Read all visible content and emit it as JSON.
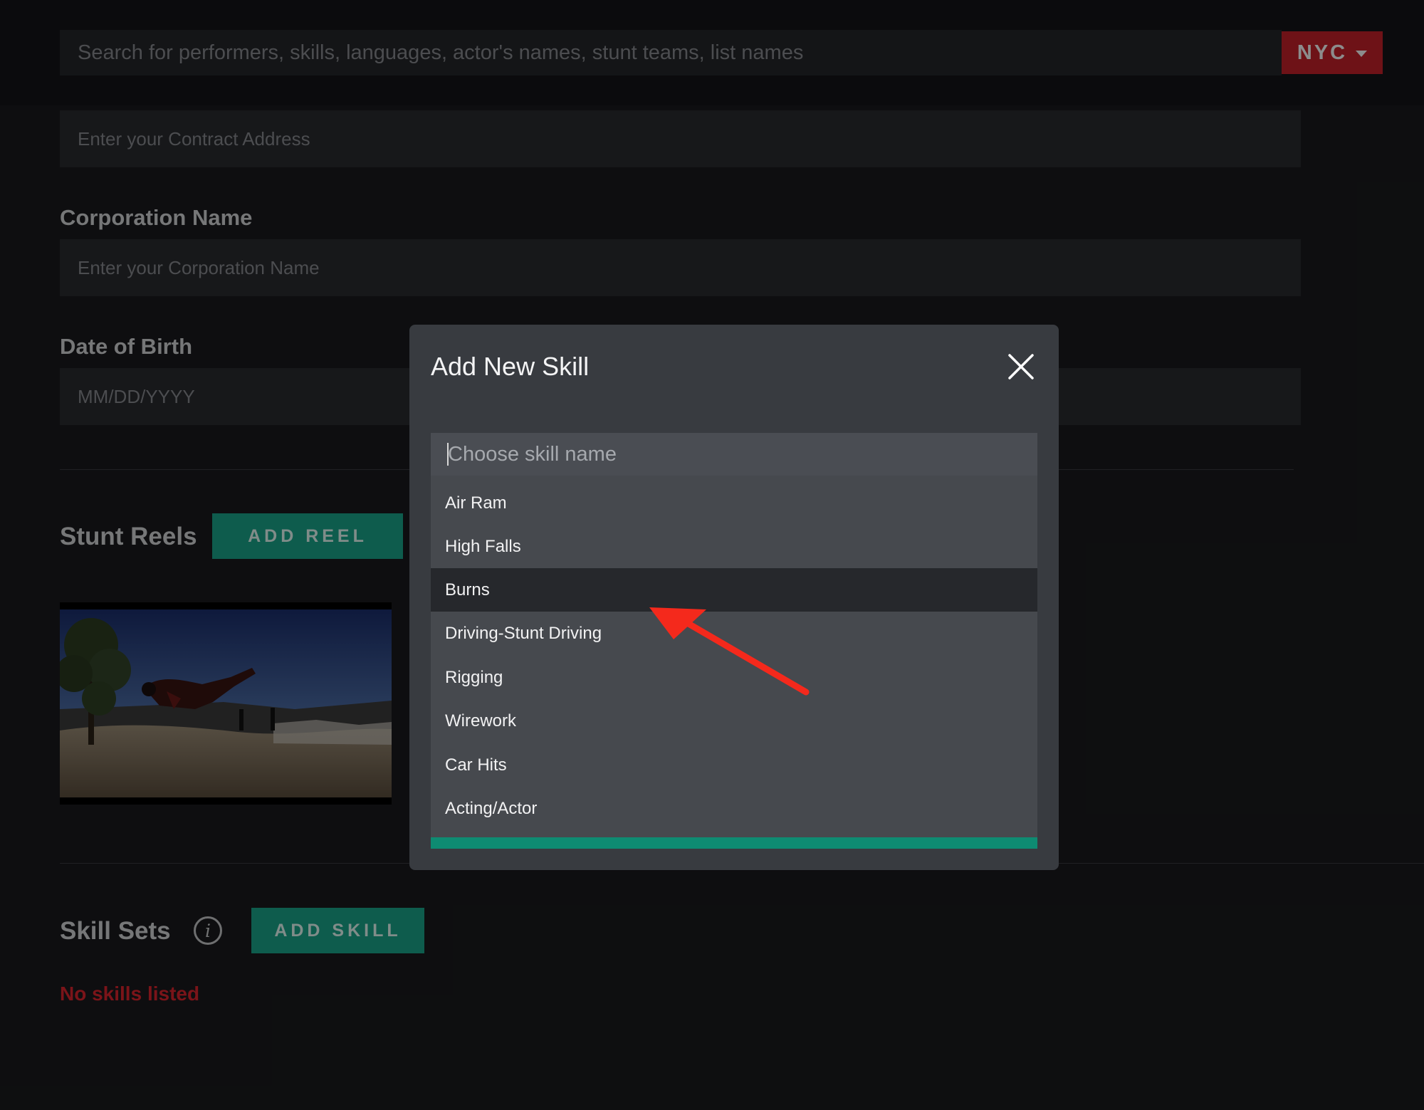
{
  "search": {
    "placeholder": "Search for performers, skills, languages, actor's names, stunt teams, list names",
    "city": "NYC"
  },
  "form": {
    "contract_address_placeholder": "Enter your Contract Address",
    "corporation_label": "Corporation Name",
    "corporation_placeholder": "Enter your Corporation Name",
    "dob_label": "Date of Birth",
    "dob_placeholder": "MM/DD/YYYY"
  },
  "stunt_reels": {
    "title": "Stunt Reels",
    "add_button": "ADD REEL"
  },
  "skill_sets": {
    "title": "Skill Sets",
    "info_glyph": "i",
    "add_button": "ADD SKILL",
    "empty_text": "No skills listed"
  },
  "modal": {
    "title": "Add New Skill",
    "input_placeholder": "Choose skill name",
    "options": [
      "Air Ram",
      "High Falls",
      "Burns",
      "Driving-Stunt Driving",
      "Rigging",
      "Wirework",
      "Car Hits",
      "Acting/Actor"
    ],
    "selected_option": "Burns"
  },
  "colors": {
    "accent_red": "#c9222a",
    "accent_teal": "#1aa88d",
    "annotation_arrow": "#f4291c"
  },
  "icons": [
    "chevron-down-icon",
    "info-icon",
    "close-icon",
    "annotation-arrow-icon"
  ]
}
